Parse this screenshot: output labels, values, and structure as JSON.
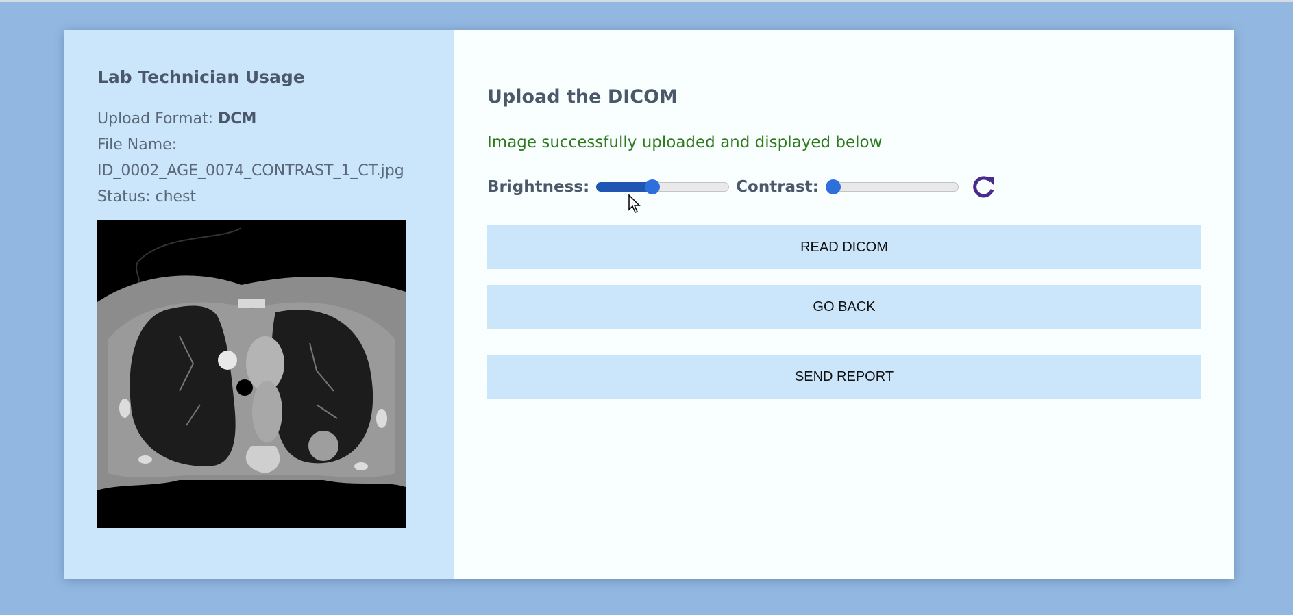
{
  "sidebar": {
    "title": "Lab Technician Usage",
    "upload_format_label": "Upload Format:",
    "upload_format_value": "DCM",
    "file_name_label": "File Name:",
    "file_name_value": "ID_0002_AGE_0074_CONTRAST_1_CT.jpg",
    "status_label": "Status:",
    "status_value": "chest"
  },
  "main": {
    "title": "Upload the DICOM",
    "success_message": "Image successfully uploaded and displayed below",
    "brightness_label": "Brightness:",
    "brightness_level": 0.37,
    "contrast_label": "Contrast:",
    "contrast_level": 0.0,
    "reset_icon": "refresh-icon",
    "buttons": {
      "read": "READ DICOM",
      "back": "GO BACK",
      "report": "SEND REPORT"
    }
  },
  "colors": {
    "background": "#92b8e2",
    "sidebar": "#cbe5fb",
    "success": "#2f7a1c",
    "accent": "#2f6fdb",
    "refresh_icon": "#4a2a8a"
  }
}
